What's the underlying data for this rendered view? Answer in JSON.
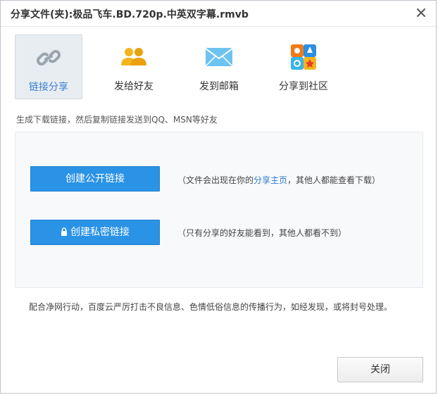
{
  "dialog": {
    "title": "分享文件(夹):极品飞车.BD.720p.中英双字幕.rmvb",
    "close_icon": "close-icon"
  },
  "tabs": [
    {
      "label": "链接分享",
      "icon": "link-icon",
      "active": true
    },
    {
      "label": "发给好友",
      "icon": "friends-icon",
      "active": false
    },
    {
      "label": "发到邮箱",
      "icon": "mail-icon",
      "active": false
    },
    {
      "label": "分享到社区",
      "icon": "community-icon",
      "active": false
    }
  ],
  "hint": "生成下载链接，然后复制链接发送到QQ、MSN等好友",
  "public_link": {
    "button_label": "创建公开链接",
    "note_prefix": "（文件会出现在你的",
    "note_link": "分享主页",
    "note_suffix": "，其他人都能查看下载）"
  },
  "private_link": {
    "button_label": "创建私密链接",
    "icon": "lock-icon",
    "note": "（只有分享的好友能看到，其他人都看不到）"
  },
  "footer_note": "配合净网行动，百度云严厉打击不良信息、色情低俗信息的传播行为，如经发现，或将封号处理。",
  "close_button": {
    "label": "关闭"
  },
  "colors": {
    "primary_button": "#2a93e6",
    "link": "#2a7ad0",
    "active_tab_bg": "#e8edf2"
  }
}
